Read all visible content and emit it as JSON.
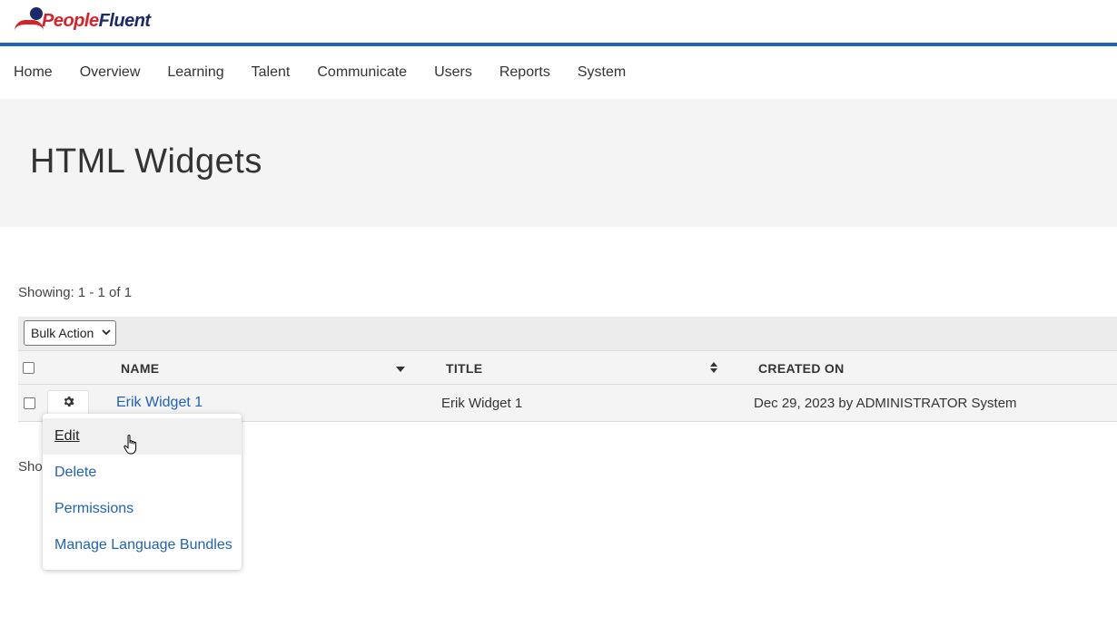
{
  "brand": {
    "part1": "People",
    "part2": "Fluent"
  },
  "nav": {
    "items": [
      "Home",
      "Overview",
      "Learning",
      "Talent",
      "Communicate",
      "Users",
      "Reports",
      "System"
    ]
  },
  "page": {
    "title": "HTML Widgets"
  },
  "pager": {
    "top": "Showing: 1 - 1 of 1",
    "bottom_visible": "Sho"
  },
  "bulk_action": {
    "selected": "Bulk Action"
  },
  "table": {
    "columns": [
      "NAME",
      "TITLE",
      "CREATED ON"
    ],
    "rows": [
      {
        "name": "Erik Widget 1",
        "title": "Erik Widget 1",
        "created": "Dec 29, 2023 by ADMINISTRATOR System"
      }
    ]
  },
  "row_menu": {
    "items": [
      "Edit",
      "Delete",
      "Permissions",
      "Manage Language Bundles"
    ],
    "hovered": "Edit"
  },
  "icons": {
    "settings": "gear-icon",
    "sort_desc": "caret-down-icon",
    "sort_both": "sort-icon",
    "cursor": "hand-pointer-icon"
  },
  "colors": {
    "brand_blue": "#2062b6",
    "brand_red": "#d6232a",
    "brand_navy": "#1b2a6b",
    "band_gray": "#f4f4f4"
  }
}
